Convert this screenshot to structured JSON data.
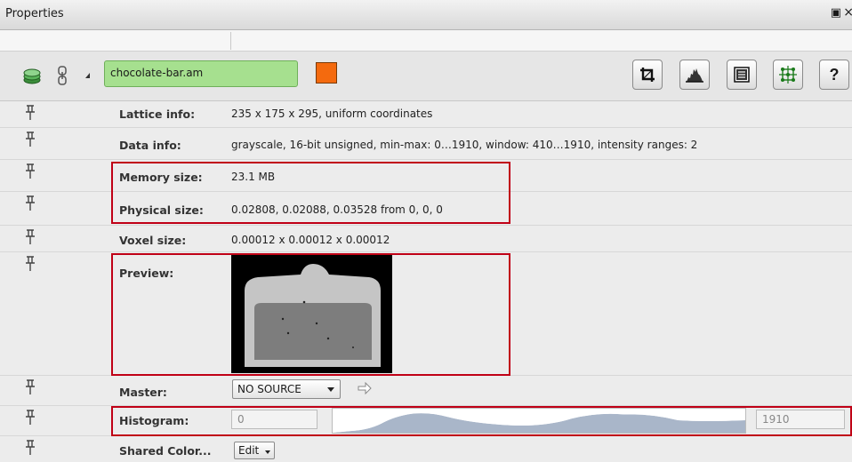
{
  "panel": {
    "title": "Properties",
    "float_icon": "restore-icon",
    "close_icon": "close-icon"
  },
  "module": {
    "name": "chocolate-bar.am",
    "swatch_color": "#f46a0e",
    "field_color": "#a6e08f",
    "icons": [
      "layers-icon",
      "link-icon",
      "collapse-triangle-icon"
    ]
  },
  "toolbar": {
    "buttons": [
      {
        "name": "crop-editor-button",
        "icon": "crop-icon"
      },
      {
        "name": "histogram-button",
        "icon": "histogram-icon"
      },
      {
        "name": "parameter-editor-button",
        "icon": "list-icon"
      },
      {
        "name": "transform-editor-button",
        "icon": "transform-icon"
      },
      {
        "name": "help-button",
        "icon": "help-icon",
        "label": "?"
      }
    ]
  },
  "properties": {
    "lattice": {
      "label": "Lattice info:",
      "value": "235 x 175 x 295, uniform coordinates"
    },
    "data": {
      "label": "Data info:",
      "value": "grayscale, 16-bit unsigned, min-max: 0…1910, window: 410…1910, intensity ranges: 2"
    },
    "memory": {
      "label": "Memory size:",
      "value": "23.1 MB"
    },
    "physical": {
      "label": "Physical size:",
      "value": "0.02808, 0.02088, 0.03528  from 0, 0, 0"
    },
    "voxel": {
      "label": "Voxel size:",
      "value": "0.00012 x 0.00012 x 0.00012"
    },
    "preview": {
      "label": "Preview:"
    },
    "master": {
      "label": "Master:",
      "select_value": "NO SOURCE"
    },
    "histogram": {
      "label": "Histogram:",
      "min": "0",
      "max": "1910"
    },
    "shared_color": {
      "label": "Shared Color...",
      "edit_label": "Edit"
    }
  },
  "colors": {
    "highlight": "#c00016",
    "histogram_fill": "#a9b6c9"
  }
}
